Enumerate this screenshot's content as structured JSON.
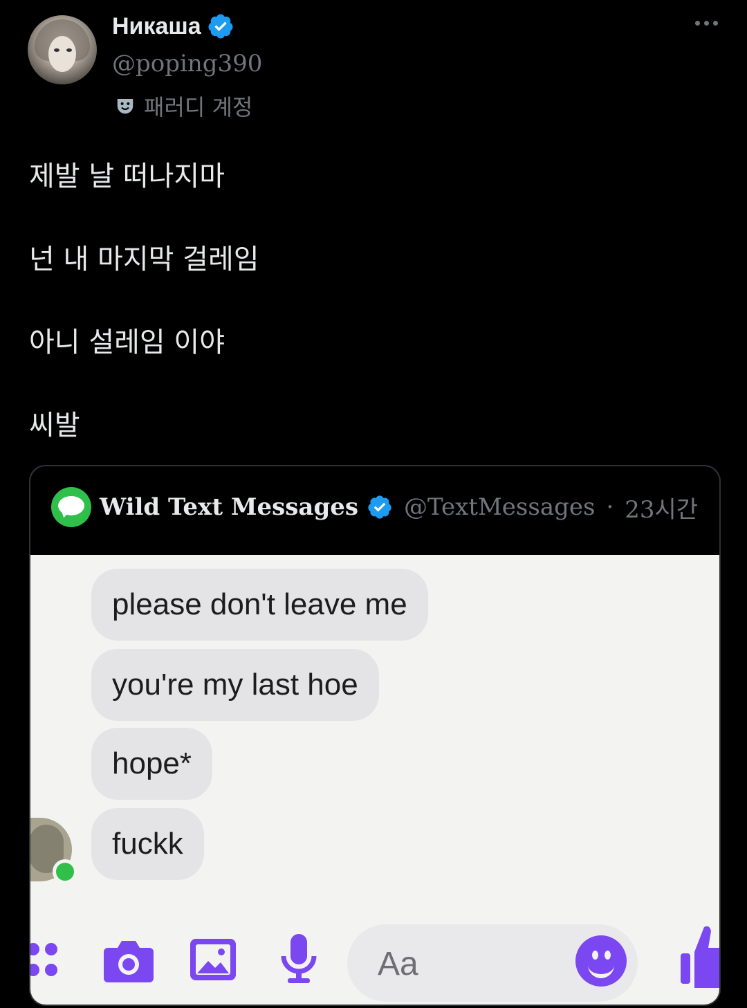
{
  "tweet": {
    "author": {
      "display_name": "Никаша",
      "handle": "@poping390",
      "parody_label": "패러디 계정"
    },
    "lines": [
      "제발 날 떠나지마",
      "넌 내 마지막 걸레임",
      "아니 설레임 이야",
      "씨발"
    ]
  },
  "quote": {
    "author": {
      "display_name": "Wild Text Messages",
      "handle": "@TextMessages",
      "separator": "·",
      "time": "23시간"
    },
    "messages": [
      "please don't leave me",
      "you're my last hoe",
      "hope*",
      "fuckk"
    ],
    "composer": {
      "placeholder": "Aa"
    }
  },
  "colors": {
    "background": "#000000",
    "text_primary": "#e7e9ea",
    "text_secondary": "#71767b",
    "verified_blue": "#1d9bf0",
    "messenger_purple": "#7a47f0",
    "bubble_gray": "#e4e4e6",
    "imessage_green": "#2fbf4a"
  },
  "icons": [
    "verified-badge-icon",
    "parody-mask-icon",
    "more-options-icon",
    "menu-dots-icon",
    "camera-icon",
    "image-icon",
    "microphone-icon",
    "emoji-icon",
    "thumbs-up-icon"
  ]
}
